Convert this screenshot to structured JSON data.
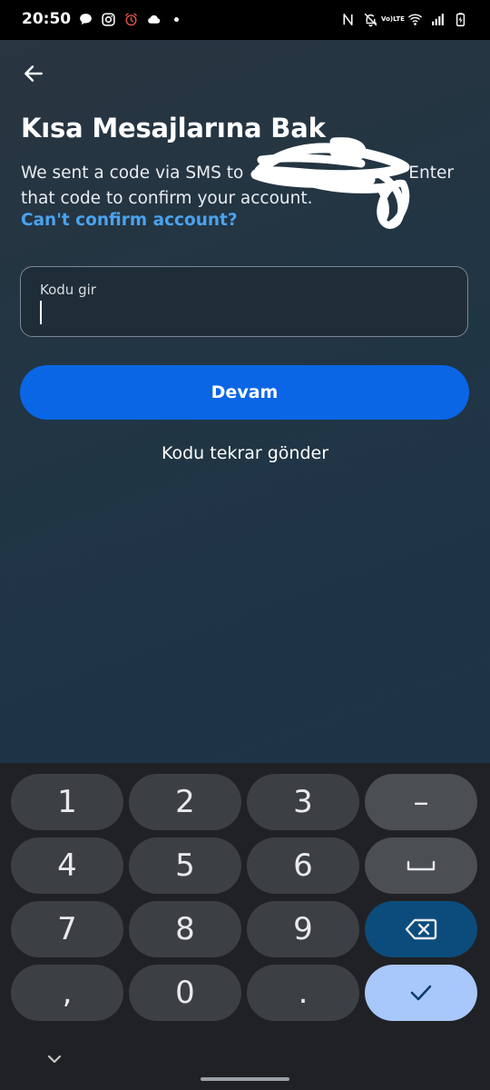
{
  "status_bar": {
    "time": "20:50",
    "volte_top": "Vo)",
    "volte_bottom": "LTE",
    "left_icons": [
      "chat-bubble-icon",
      "instagram-icon",
      "alarm-icon",
      "cloud-icon",
      "dot-icon"
    ],
    "right_icons": [
      "nfc-icon",
      "mute-icon",
      "volte-icon",
      "wifi-icon",
      "signal-icon",
      "battery-charging-icon"
    ]
  },
  "header": {
    "back_icon": "arrow-left-icon",
    "title": "Kısa Mesajlarına Bak"
  },
  "description": {
    "before_redaction": "We sent a code via SMS to",
    "after_redaction": "Enter that code to confirm your account.",
    "help_link": "Can't confirm account?"
  },
  "form": {
    "code_label": "Kodu gir",
    "code_value": "",
    "continue_label": "Devam",
    "resend_label": "Kodu tekrar gönder"
  },
  "keyboard": {
    "keys": [
      "1",
      "2",
      "3",
      "–",
      "4",
      "5",
      "6",
      "7",
      "8",
      "9",
      ",",
      "0",
      "."
    ],
    "function_icons": [
      "space-icon",
      "backspace-icon",
      "checkmark-icon",
      "chevron-down-icon"
    ],
    "colors": {
      "background": "#202124",
      "key": "#3c3f43",
      "function_key": "#4b4e52",
      "backspace": "#0c4c7c",
      "done": "#a8c7fa"
    }
  },
  "colors": {
    "primary_button": "#0a66e5",
    "link": "#4aa3ee",
    "text": "#ffffff"
  }
}
